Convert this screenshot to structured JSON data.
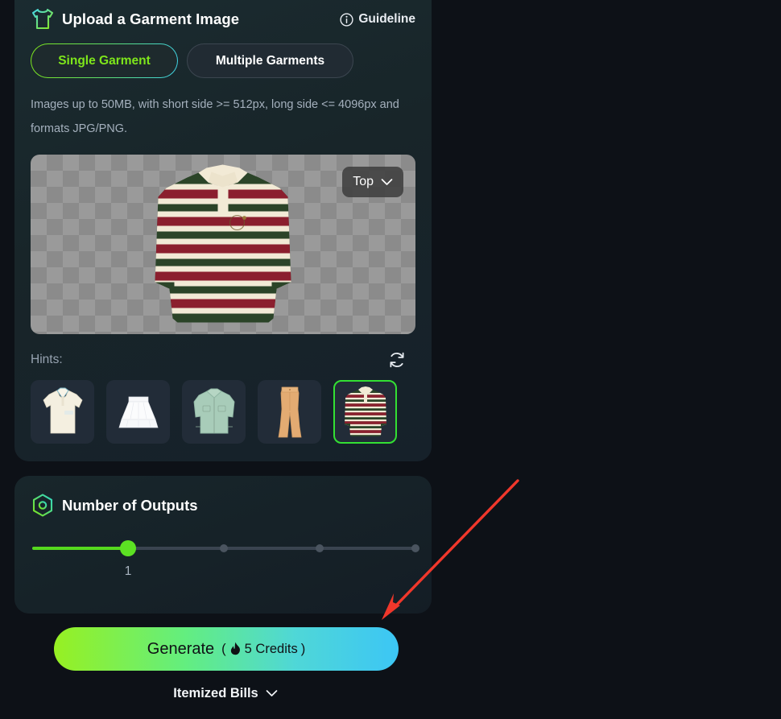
{
  "header": {
    "title": "Upload a Garment Image",
    "icon": "tshirt-icon",
    "guideline_label": "Guideline",
    "guideline_icon": "info-circle-icon"
  },
  "tabs": [
    {
      "label": "Single Garment",
      "active": true
    },
    {
      "label": "Multiple Garments",
      "active": false
    }
  ],
  "note": "Images up to 50MB, with short side >= 512px, long side <= 4096px and formats JPG/PNG.",
  "preview": {
    "dropdown_value": "Top",
    "dropdown_icon": "chevron-down-icon",
    "garment_alt": "green-striped-rugby-polo"
  },
  "hints": {
    "label": "Hints:",
    "refresh_icon": "refresh-icon",
    "items": [
      {
        "name": "cream-polo-shirt",
        "selected": false
      },
      {
        "name": "white-pleated-skirt",
        "selected": false
      },
      {
        "name": "mint-denim-jacket",
        "selected": false
      },
      {
        "name": "tan-flared-pants",
        "selected": false
      },
      {
        "name": "green-striped-rugby-polo",
        "selected": true
      }
    ]
  },
  "outputs": {
    "title": "Number of Outputs",
    "icon": "hexagon-icon",
    "value": "1",
    "slider": {
      "min": 1,
      "max": 4,
      "current": 1,
      "fill_percent": 25,
      "ticks_percent": [
        50,
        75,
        100
      ]
    }
  },
  "generate": {
    "label": "Generate",
    "credits_open": "(",
    "credits_text": "5 Credits",
    "credits_close": ")",
    "credits_icon": "flame-icon"
  },
  "itemized": {
    "label": "Itemized Bills",
    "icon": "chevron-down-icon"
  },
  "annotation": {
    "type": "arrow",
    "color": "#f0372b",
    "points_to": "generate-button"
  },
  "colors": {
    "page_bg": "#0d1117",
    "card_bg": "#1a2a2e",
    "accent_green": "#7ee61b",
    "accent_cyan": "#3cc6f5",
    "selected_border": "#33e033",
    "muted_text": "#a4b0bd"
  }
}
